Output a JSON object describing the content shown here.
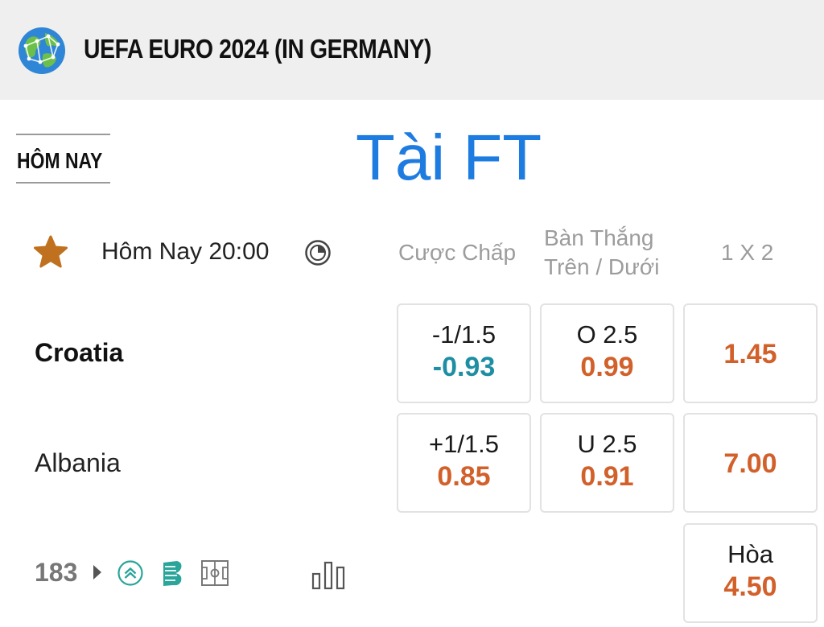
{
  "header": {
    "competition": "UEFA EURO 2024 (IN GERMANY)"
  },
  "tab": {
    "label": "HÔM NAY"
  },
  "overlay_title": "Tài FT",
  "match": {
    "time": "Hôm Nay 20:00"
  },
  "columns": {
    "handicap": "Cược Chấp",
    "over_under_line1": "Bàn Thắng",
    "over_under_line2": "Trên / Dưới",
    "one_x_two": "1 X 2"
  },
  "teams": {
    "home": {
      "name": "Croatia",
      "handicap_line": "-1/1.5",
      "handicap_odd": "-0.93",
      "ou_line": "O 2.5",
      "ou_odd": "0.99",
      "win_odd": "1.45"
    },
    "away": {
      "name": "Albania",
      "handicap_line": "+1/1.5",
      "handicap_odd": "0.85",
      "ou_line": "U 2.5",
      "ou_odd": "0.91",
      "win_odd": "7.00"
    }
  },
  "draw": {
    "label": "Hòa",
    "odd": "4.50"
  },
  "footer": {
    "count": "183"
  },
  "colors": {
    "accent": "#1e7be0",
    "odd_positive": "#d2602a",
    "odd_negative": "#1d8ea3",
    "star": "#c0711f",
    "icon_teal": "#2aa59a"
  },
  "icons": [
    "globe-icon",
    "star-icon",
    "clock-icon",
    "chevron-right-icon",
    "double-chevron-up-icon",
    "stats-b-icon",
    "pitch-icon",
    "bar-chart-icon"
  ]
}
